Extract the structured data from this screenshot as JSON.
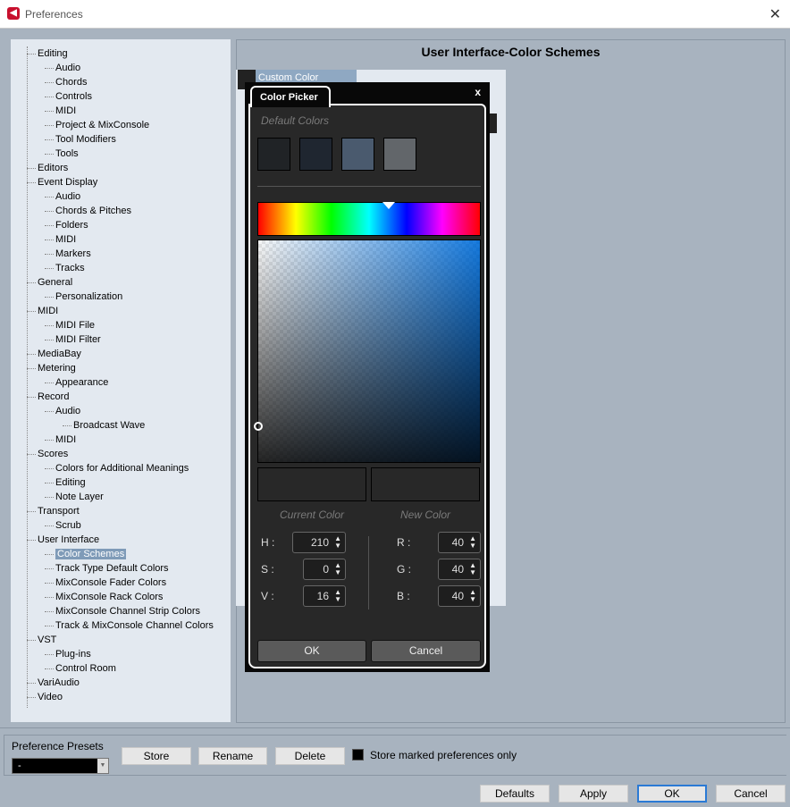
{
  "window": {
    "title": "Preferences",
    "close": "✕"
  },
  "tree": [
    [
      "Editing",
      0
    ],
    [
      "Audio",
      1
    ],
    [
      "Chords",
      1
    ],
    [
      "Controls",
      1
    ],
    [
      "MIDI",
      1
    ],
    [
      "Project & MixConsole",
      1
    ],
    [
      "Tool Modifiers",
      1
    ],
    [
      "Tools",
      1
    ],
    [
      "Editors",
      0
    ],
    [
      "Event Display",
      0
    ],
    [
      "Audio",
      1
    ],
    [
      "Chords & Pitches",
      1
    ],
    [
      "Folders",
      1
    ],
    [
      "MIDI",
      1
    ],
    [
      "Markers",
      1
    ],
    [
      "Tracks",
      1
    ],
    [
      "General",
      0
    ],
    [
      "Personalization",
      1
    ],
    [
      "MIDI",
      0
    ],
    [
      "MIDI File",
      1
    ],
    [
      "MIDI Filter",
      1
    ],
    [
      "MediaBay",
      0
    ],
    [
      "Metering",
      0
    ],
    [
      "Appearance",
      1
    ],
    [
      "Record",
      0
    ],
    [
      "Audio",
      1
    ],
    [
      "Broadcast Wave",
      2
    ],
    [
      "MIDI",
      1
    ],
    [
      "Scores",
      0
    ],
    [
      "Colors for Additional Meanings",
      1
    ],
    [
      "Editing",
      1
    ],
    [
      "Note Layer",
      1
    ],
    [
      "Transport",
      0
    ],
    [
      "Scrub",
      1
    ],
    [
      "User Interface",
      0
    ],
    [
      "Color Schemes",
      1,
      "selected"
    ],
    [
      "Track Type Default Colors",
      1
    ],
    [
      "MixConsole Fader Colors",
      1
    ],
    [
      "MixConsole Rack Colors",
      1
    ],
    [
      "MixConsole Channel Strip Colors",
      1
    ],
    [
      "Track & MixConsole Channel Colors",
      1
    ],
    [
      "VST",
      0
    ],
    [
      "Plug-ins",
      1
    ],
    [
      "Control Room",
      1
    ],
    [
      "VariAudio",
      0
    ],
    [
      "Video",
      0
    ]
  ],
  "main": {
    "title": "User Interface-Color Schemes",
    "scheme_label": "Custom Color Scheme"
  },
  "color_picker": {
    "title": "Color Picker",
    "close": "x",
    "default_colors_label": "Default Colors",
    "default_colors": [
      "#202326",
      "#1f2630",
      "#4a5a6e",
      "#62666a"
    ],
    "hue_fraction": 0.583,
    "current_color_label": "Current Color",
    "new_color_label": "New Color",
    "current_color": "#282828",
    "new_color": "#282828",
    "hsv": {
      "h_label": "H :",
      "h": "210",
      "s_label": "S :",
      "s": "0",
      "v_label": "V :",
      "v": "16"
    },
    "rgb": {
      "r_label": "R :",
      "r": "40",
      "g_label": "G :",
      "g": "40",
      "b_label": "B :",
      "b": "40"
    },
    "ok": "OK",
    "cancel": "Cancel"
  },
  "presets": {
    "label": "Preference Presets",
    "value": "-",
    "store": "Store",
    "rename": "Rename",
    "delete": "Delete",
    "checkbox_label": "Store marked preferences only",
    "checkbox_checked": true
  },
  "footer": {
    "defaults": "Defaults",
    "apply": "Apply",
    "ok": "OK",
    "cancel": "Cancel"
  }
}
